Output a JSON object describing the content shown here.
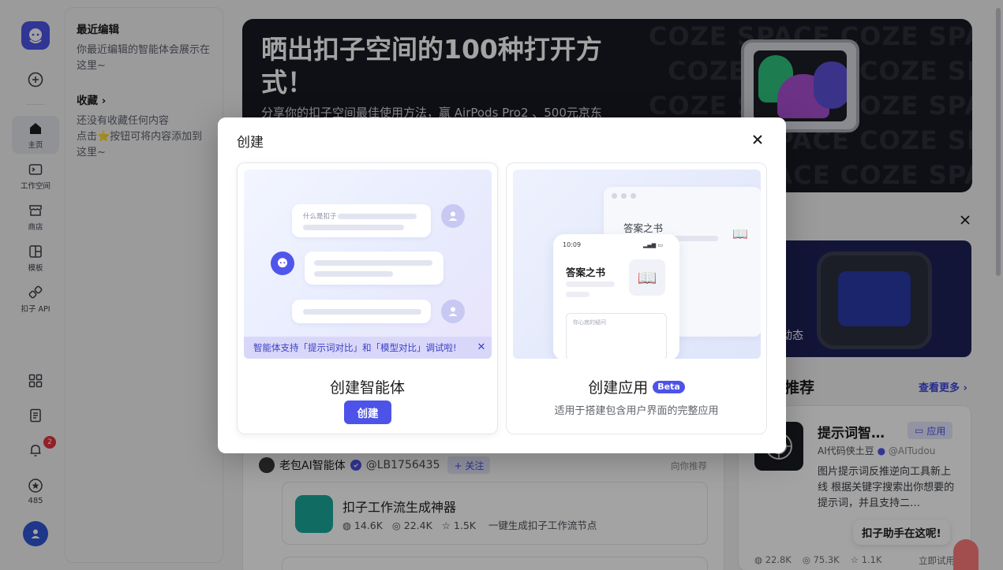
{
  "rail": {
    "nav": [
      {
        "label": "主页",
        "icon": "home-icon"
      },
      {
        "label": "工作空间",
        "icon": "workspace-icon"
      },
      {
        "label": "商店",
        "icon": "store-icon"
      },
      {
        "label": "模板",
        "icon": "template-icon"
      },
      {
        "label": "扣子 API",
        "icon": "api-icon"
      }
    ],
    "notification_count": "2",
    "points": "485"
  },
  "recent": {
    "title": "最近编辑",
    "empty": "你最近编辑的智能体会展示在这里~",
    "fav_title": "收藏 ›",
    "fav_empty": "还没有收藏任何内容",
    "fav_hint": "点击⭐按钮可将内容添加到这里~"
  },
  "banner": {
    "title": "晒出扣子空间的100种打开方式！",
    "subtitle": "分享你的扣子空间最佳使用方法，赢 AirPods Pro2 、500元京东",
    "watermark": "COZE SPACE"
  },
  "recommend": {
    "card_text": "动态",
    "heading": "推荐",
    "more": "查看更多 ›",
    "app": {
      "title": "提示词智…",
      "tag": "应用",
      "author": "AI代码侠土豆",
      "handle": "@AITudou",
      "desc": "图片提示词反推逆向工具新上线 根据关键字搜索出你想要的提示词，并且支持二…",
      "users": "22.8K",
      "runs": "75.3K",
      "stars": "1.1K",
      "try": "立即试用"
    }
  },
  "feed": {
    "author": "老包AI智能体",
    "handle": "@LB1756435",
    "follow": "+ 关注",
    "hint": "向你推荐",
    "item": {
      "title": "扣子工作流生成神器",
      "users": "14.6K",
      "runs": "22.4K",
      "stars": "1.5K",
      "desc": "一键生成扣子工作流节点"
    }
  },
  "assistant": "扣子助手在这呢!",
  "modal": {
    "title": "创建",
    "agent": {
      "title": "创建智能体",
      "button": "创建",
      "notice": "智能体支持「提示词对比」和「模型对比」调试啦!",
      "preview_question": "什么是扣子"
    },
    "app": {
      "title": "创建应用",
      "badge": "Beta",
      "desc": "适用于搭建包含用户界面的完整应用",
      "preview_title": "答案之书",
      "phone_time": "10:09",
      "phone_title": "答案之书",
      "phone_placeholder": "你心底的疑问"
    }
  },
  "colors": {
    "accent": "#4d53e8",
    "overlay": "rgba(0,0,0,0.36)",
    "badge": "#e5323c"
  }
}
